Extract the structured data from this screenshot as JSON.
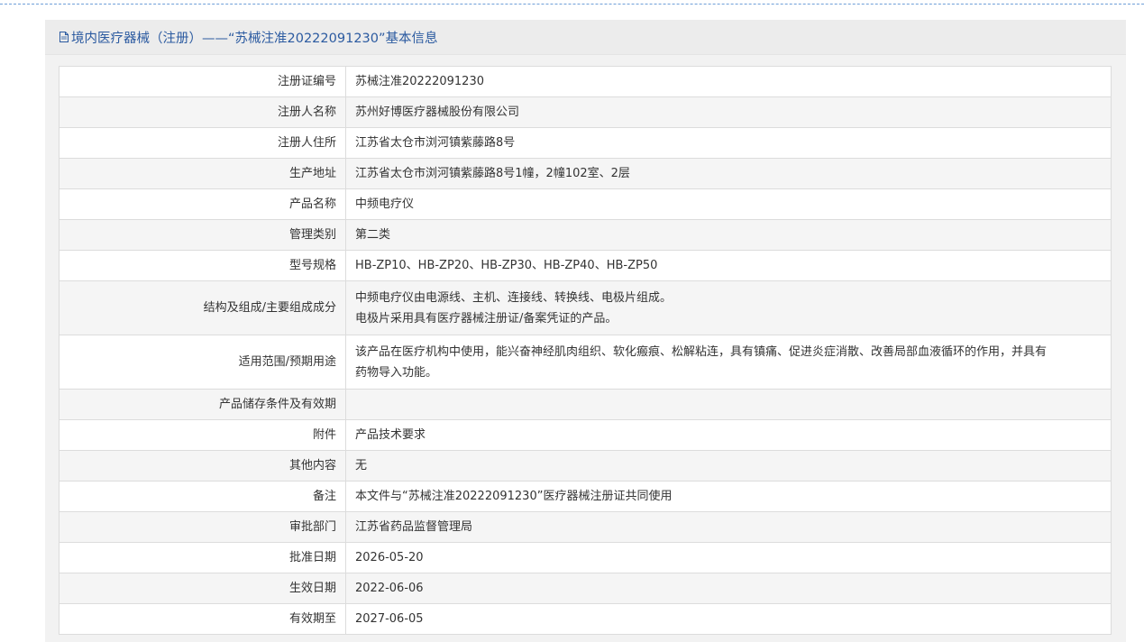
{
  "header": {
    "title": "境内医疗器械（注册）——“苏械注准20222091230”基本信息",
    "icon": "document-icon",
    "accent_color": "#2b5aa0"
  },
  "rows": [
    {
      "label": "注册证编号",
      "value": "苏械注准20222091230"
    },
    {
      "label": "注册人名称",
      "value": "苏州好博医疗器械股份有限公司"
    },
    {
      "label": "注册人住所",
      "value": "江苏省太仓市浏河镇紫藤路8号"
    },
    {
      "label": "生产地址",
      "value": "江苏省太仓市浏河镇紫藤路8号1幢，2幢102室、2层"
    },
    {
      "label": "产品名称",
      "value": "中频电疗仪"
    },
    {
      "label": "管理类别",
      "value": "第二类"
    },
    {
      "label": "型号规格",
      "value": "HB-ZP10、HB-ZP20、HB-ZP30、HB-ZP40、HB-ZP50"
    },
    {
      "label": "结构及组成/主要组成成分",
      "value_lines": [
        "中频电疗仪由电源线、主机、连接线、转换线、电极片组成。",
        "电极片采用具有医疗器械注册证/备案凭证的产品。"
      ]
    },
    {
      "label": "适用范围/预期用途",
      "value_lines": [
        "该产品在医疗机构中使用，能兴奋神经肌肉组织、软化瘢痕、松解粘连，具有镇痛、促进炎症消散、改善局部血液循环的作用，并具有",
        "药物导入功能。"
      ]
    },
    {
      "label": "产品储存条件及有效期",
      "value": ""
    },
    {
      "label": "附件",
      "value": "产品技术要求"
    },
    {
      "label": "其他内容",
      "value": "无"
    },
    {
      "label": "备注",
      "value": "本文件与“苏械注准20222091230”医疗器械注册证共同使用"
    },
    {
      "label": "审批部门",
      "value": "江苏省药品监督管理局"
    },
    {
      "label": "批准日期",
      "value": "2026-05-20"
    },
    {
      "label": "生效日期",
      "value": "2022-06-06"
    },
    {
      "label": "有效期至",
      "value": "2027-06-05"
    }
  ]
}
